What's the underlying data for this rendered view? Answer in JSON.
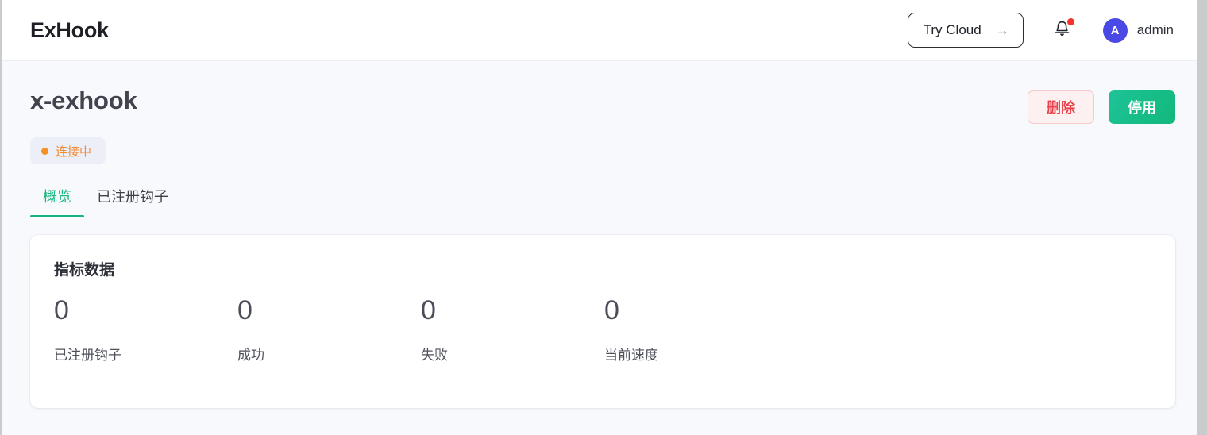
{
  "header": {
    "brand": "ExHook",
    "try_cloud_label": "Try Cloud",
    "try_cloud_arrow": "→",
    "bell_icon": "bell-icon",
    "notification_badge": "",
    "avatar_initial": "A",
    "username": "admin"
  },
  "page": {
    "title": "x-exhook",
    "status": {
      "label": "连接中",
      "dot_color": "#f49227",
      "text_color": "#f08a33",
      "background": "#edeff8"
    },
    "actions": {
      "delete_label": "删除",
      "disable_label": "停用",
      "delete_color": "#e8434c",
      "disable_color": "#16bd86"
    },
    "tabs": [
      {
        "label": "概览",
        "active": true
      },
      {
        "label": "已注册钩子",
        "active": false
      }
    ],
    "accent_color": "#16b47c"
  },
  "metrics_card": {
    "title": "指标数据",
    "metrics": [
      {
        "value": "0",
        "label": "已注册钩子"
      },
      {
        "value": "0",
        "label": "成功"
      },
      {
        "value": "0",
        "label": "失败"
      },
      {
        "value": "0",
        "label": "当前速度"
      }
    ]
  }
}
